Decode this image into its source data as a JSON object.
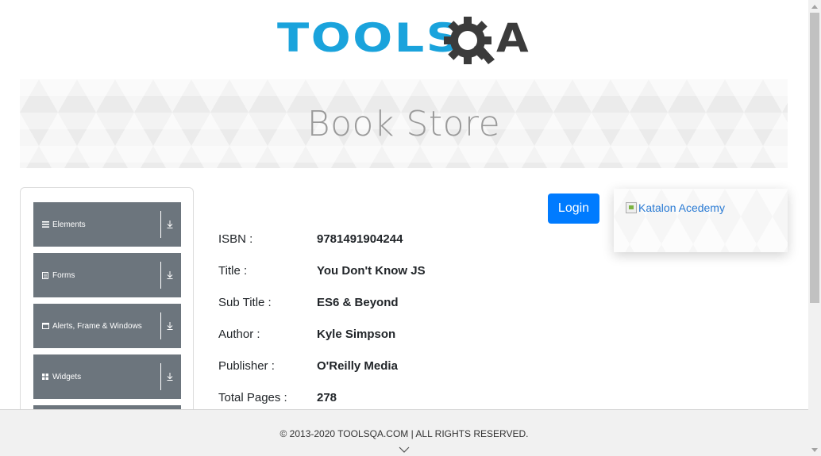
{
  "logo": {
    "main": "TOOLS",
    "q": "Q",
    "a": "A"
  },
  "banner": {
    "title": "Book Store"
  },
  "sidebar": {
    "groups": [
      {
        "label": "Elements",
        "icon": "hamburger-icon"
      },
      {
        "label": "Forms",
        "icon": "form-icon"
      },
      {
        "label": "Alerts, Frame & Windows",
        "icon": "window-icon"
      },
      {
        "label": "Widgets",
        "icon": "grid-icon"
      }
    ]
  },
  "login": {
    "label": "Login"
  },
  "book": {
    "rows": [
      {
        "label": "ISBN :",
        "value": "9781491904244"
      },
      {
        "label": "Title :",
        "value": "You Don't Know JS"
      },
      {
        "label": "Sub Title :",
        "value": "ES6 & Beyond"
      },
      {
        "label": "Author :",
        "value": "Kyle Simpson"
      },
      {
        "label": "Publisher :",
        "value": "O'Reilly Media"
      },
      {
        "label": "Total Pages :",
        "value": "278"
      }
    ]
  },
  "ad": {
    "alt": "Katalon Acedemy"
  },
  "footer": {
    "text": "© 2013-2020 TOOLSQA.COM | ALL RIGHTS RESERVED."
  },
  "colors": {
    "brand_blue": "#1aa3dc",
    "button_blue": "#007bff",
    "sidebar_gray": "#6c757d",
    "link_blue": "#2a7bd4"
  }
}
